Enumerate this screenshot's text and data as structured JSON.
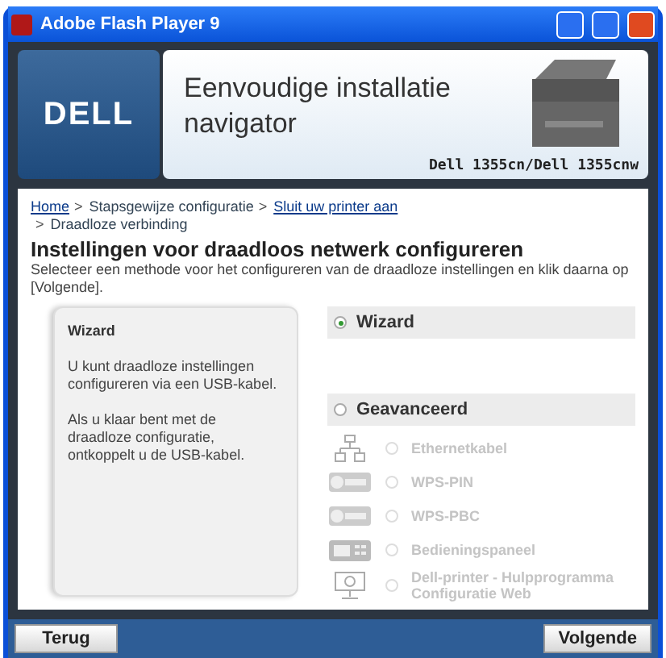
{
  "window": {
    "title": "Adobe Flash Player 9"
  },
  "header": {
    "logo": "DELL",
    "title": "Eenvoudige installatie navigator",
    "model": "Dell 1355cn/Dell 1355cnw"
  },
  "breadcrumb_lines": [
    [
      {
        "label": "Home",
        "kind": "link"
      },
      {
        "label": ">",
        "kind": "separator"
      },
      {
        "label": "Stapsgewijze configuratie",
        "kind": "text"
      },
      {
        "label": ">",
        "kind": "separator"
      },
      {
        "label": "Sluit uw printer aan",
        "kind": "link"
      }
    ],
    [
      {
        "label": ">",
        "kind": "separator"
      },
      {
        "label": "Draadloze verbinding",
        "kind": "text"
      }
    ]
  ],
  "heading": "Instellingen voor draadloos netwerk configureren",
  "instruction": "Selecteer een methode voor het configureren van de draadloze instellingen en klik daarna op [Volgende].",
  "info_panel": {
    "title": "Wizard",
    "paragraphs": [
      "U kunt draadloze instellingen configureren via een USB-kabel.",
      "Als u klaar bent met de draadloze configuratie, ontkoppelt u de USB-kabel."
    ]
  },
  "methods": [
    {
      "label": "Wizard",
      "selected": true
    },
    {
      "label": "Geavanceerd",
      "selected": false,
      "options": [
        {
          "label": "Ethernetkabel",
          "kind": "network",
          "selected": false,
          "disabled": true
        },
        {
          "label": "WPS-PIN",
          "kind": "wps",
          "selected": false,
          "disabled": true
        },
        {
          "label": "WPS-PBC",
          "kind": "wps",
          "selected": false,
          "disabled": true
        },
        {
          "label": "Bedieningspaneel",
          "kind": "panel",
          "selected": false,
          "disabled": true
        },
        {
          "label": "Dell-printer - Hulpprogramma Configuratie Web",
          "kind": "monitor",
          "selected": false,
          "disabled": true
        }
      ]
    }
  ],
  "buttons": {
    "back": "Terug",
    "next": "Volgende"
  }
}
